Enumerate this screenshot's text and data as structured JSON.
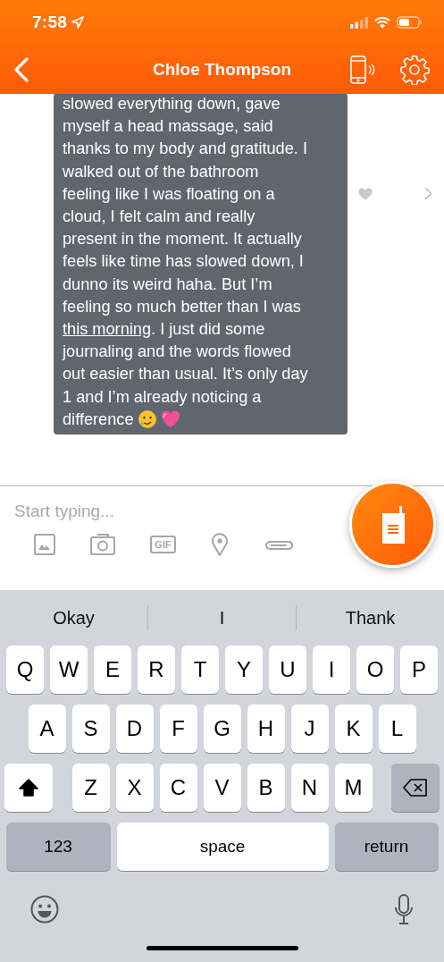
{
  "status_bar": {
    "time": "7:58"
  },
  "header": {
    "title": "Chloe Thompson"
  },
  "message": {
    "liked": false,
    "lines": [
      [
        {
          "kind": "plain",
          "text": "slowed everything down, gave"
        }
      ],
      [
        {
          "kind": "plain",
          "text": "myself a head massage, said"
        }
      ],
      [
        {
          "kind": "plain",
          "text": "thanks to my body and gratitude. I"
        }
      ],
      [
        {
          "kind": "plain",
          "text": "walked out of the bathroom"
        }
      ],
      [
        {
          "kind": "plain",
          "text": "feeling like I was floating on a"
        }
      ],
      [
        {
          "kind": "plain",
          "text": "cloud, I felt calm and really"
        }
      ],
      [
        {
          "kind": "plain",
          "text": "present in the moment. It actually"
        }
      ],
      [
        {
          "kind": "plain",
          "text": "feels like time has slowed down, I"
        }
      ],
      [
        {
          "kind": "plain",
          "text": "dunno its weird haha. But I’m"
        }
      ],
      [
        {
          "kind": "plain",
          "text": "feeling so much better than I was"
        }
      ],
      [
        {
          "kind": "link",
          "text": "this morning"
        },
        {
          "kind": "plain",
          "text": ". I just did some"
        }
      ],
      [
        {
          "kind": "plain",
          "text": "journaling and the words flowed"
        }
      ],
      [
        {
          "kind": "plain",
          "text": "out easier than usual. It’s only day"
        }
      ],
      [
        {
          "kind": "plain",
          "text": "1 and I’m already noticing a"
        }
      ],
      [
        {
          "kind": "plain",
          "text": "difference"
        },
        {
          "kind": "emoji-tear"
        },
        {
          "kind": "emoji-heart"
        }
      ]
    ]
  },
  "composer": {
    "placeholder": "Start typing...",
    "tools": [
      {
        "kind": "image"
      },
      {
        "kind": "camera"
      },
      {
        "kind": "gif",
        "label": "GIF"
      },
      {
        "kind": "location"
      },
      {
        "kind": "attach"
      }
    ]
  },
  "keyboard": {
    "suggestions": [
      "Okay",
      "I",
      "Thank"
    ],
    "rows": [
      [
        {
          "kind": "letter",
          "label": "Q"
        },
        {
          "kind": "letter",
          "label": "W"
        },
        {
          "kind": "letter",
          "label": "E"
        },
        {
          "kind": "letter",
          "label": "R"
        },
        {
          "kind": "letter",
          "label": "T"
        },
        {
          "kind": "letter",
          "label": "Y"
        },
        {
          "kind": "letter",
          "label": "U"
        },
        {
          "kind": "letter",
          "label": "I"
        },
        {
          "kind": "letter",
          "label": "O"
        },
        {
          "kind": "letter",
          "label": "P"
        }
      ],
      [
        {
          "kind": "letter",
          "label": "A"
        },
        {
          "kind": "letter",
          "label": "S"
        },
        {
          "kind": "letter",
          "label": "D"
        },
        {
          "kind": "letter",
          "label": "F"
        },
        {
          "kind": "letter",
          "label": "G"
        },
        {
          "kind": "letter",
          "label": "H"
        },
        {
          "kind": "letter",
          "label": "J"
        },
        {
          "kind": "letter",
          "label": "K"
        },
        {
          "kind": "letter",
          "label": "L"
        }
      ],
      [
        {
          "kind": "shift",
          "on": true
        },
        {
          "kind": "letter",
          "label": "Z"
        },
        {
          "kind": "letter",
          "label": "X"
        },
        {
          "kind": "letter",
          "label": "C"
        },
        {
          "kind": "letter",
          "label": "V"
        },
        {
          "kind": "letter",
          "label": "B"
        },
        {
          "kind": "letter",
          "label": "N"
        },
        {
          "kind": "letter",
          "label": "M"
        },
        {
          "kind": "backspace"
        }
      ]
    ],
    "bottom_keys": [
      {
        "kind": "mode",
        "label": "123"
      },
      {
        "kind": "space",
        "label": "space"
      },
      {
        "kind": "return",
        "label": "return"
      }
    ]
  }
}
